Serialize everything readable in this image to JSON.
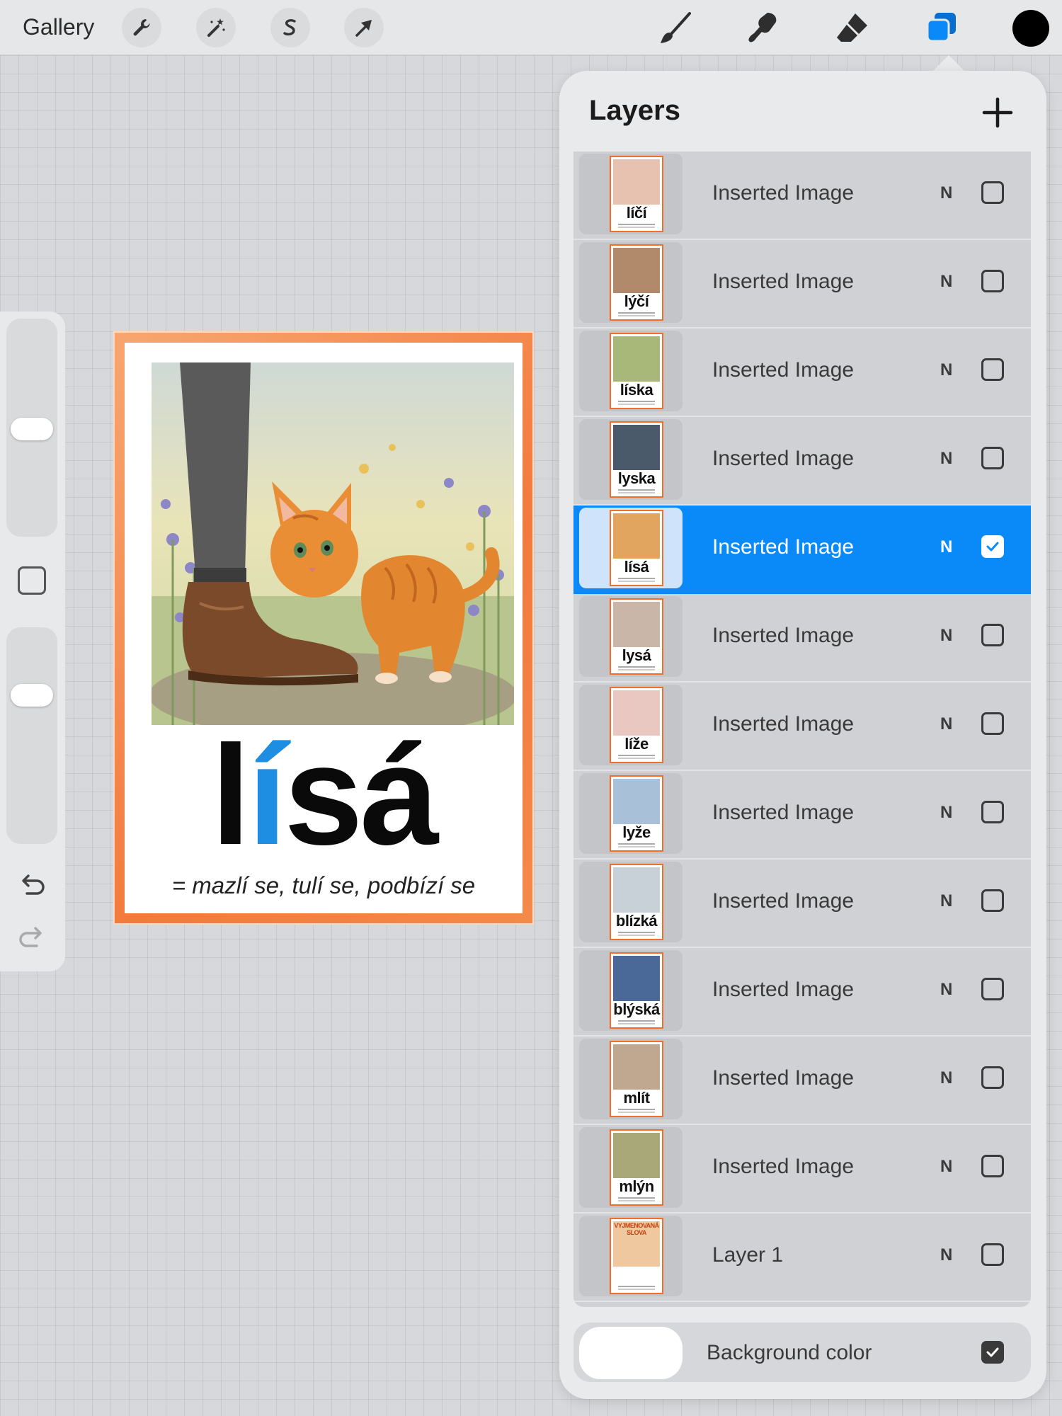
{
  "toolbar": {
    "gallery_label": "Gallery",
    "tools": [
      "wrench-icon",
      "magic-wand-icon",
      "selection-s-icon",
      "arrow-icon"
    ],
    "paint_tools": [
      "brush-icon",
      "smudge-icon",
      "eraser-icon",
      "layers-icon"
    ],
    "active_tool": "layers-icon",
    "active_color": "#000000"
  },
  "canvas": {
    "word_part1": "l",
    "word_highlight": "í",
    "word_part2": "sá",
    "definition": "= mazlí se, tulí se, podbízí se",
    "accent_color": "#1e8ee3",
    "frame_color": "#f27a3d"
  },
  "layers_panel": {
    "title": "Layers",
    "layers": [
      {
        "name": "Inserted Image",
        "blend": "N",
        "thumb_word": "líčí",
        "selected": false,
        "visible": false
      },
      {
        "name": "Inserted Image",
        "blend": "N",
        "thumb_word": "lýčí",
        "selected": false,
        "visible": false
      },
      {
        "name": "Inserted Image",
        "blend": "N",
        "thumb_word": "líska",
        "selected": false,
        "visible": false
      },
      {
        "name": "Inserted Image",
        "blend": "N",
        "thumb_word": "lyska",
        "selected": false,
        "visible": false
      },
      {
        "name": "Inserted Image",
        "blend": "N",
        "thumb_word": "lísá",
        "selected": true,
        "visible": true
      },
      {
        "name": "Inserted Image",
        "blend": "N",
        "thumb_word": "lysá",
        "selected": false,
        "visible": false
      },
      {
        "name": "Inserted Image",
        "blend": "N",
        "thumb_word": "líže",
        "selected": false,
        "visible": false
      },
      {
        "name": "Inserted Image",
        "blend": "N",
        "thumb_word": "lyže",
        "selected": false,
        "visible": false
      },
      {
        "name": "Inserted Image",
        "blend": "N",
        "thumb_word": "blízká",
        "selected": false,
        "visible": false
      },
      {
        "name": "Inserted Image",
        "blend": "N",
        "thumb_word": "blýská",
        "selected": false,
        "visible": false
      },
      {
        "name": "Inserted Image",
        "blend": "N",
        "thumb_word": "mlít",
        "selected": false,
        "visible": false
      },
      {
        "name": "Inserted Image",
        "blend": "N",
        "thumb_word": "mlýn",
        "selected": false,
        "visible": false
      },
      {
        "name": "Layer 1",
        "blend": "N",
        "thumb_word": "VYJMENOVANÁ SLOVA",
        "selected": false,
        "visible": false
      }
    ],
    "background": {
      "label": "Background color",
      "visible": true,
      "color": "#ffffff"
    }
  }
}
